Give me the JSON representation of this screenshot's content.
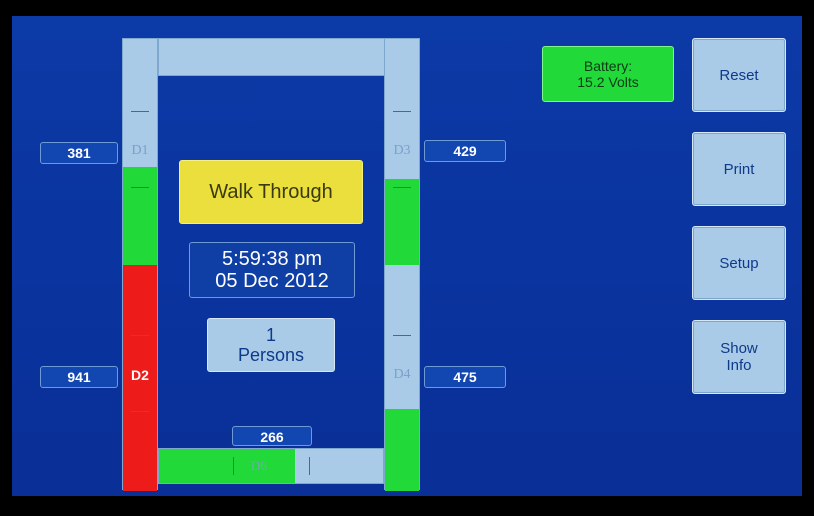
{
  "status": {
    "mode_label": "Walk Through"
  },
  "clock": {
    "time": "5:59:38 pm",
    "date": "05 Dec 2012"
  },
  "counter": {
    "count": "1",
    "unit": "Persons"
  },
  "battery": {
    "label": "Battery:",
    "value": "15.2 Volts",
    "color": "#22d93a"
  },
  "detectors": {
    "d1": {
      "label": "D1",
      "count": "381"
    },
    "d2": {
      "label": "D2",
      "count": "941"
    },
    "d3": {
      "label": "D3",
      "count": "429"
    },
    "d4": {
      "label": "D4",
      "count": "475"
    },
    "d6": {
      "label": "D6",
      "count": "266"
    }
  },
  "buttons": {
    "reset": "Reset",
    "print": "Print",
    "setup": "Setup",
    "show_info_line1": "Show",
    "show_info_line2": "Info"
  },
  "colors": {
    "active_green": "#22d93a",
    "alarm_red": "#ee1b1b",
    "idle_blue": "#a9cbe8",
    "status_yellow": "#eadf3c",
    "background": "#0a34a0"
  }
}
